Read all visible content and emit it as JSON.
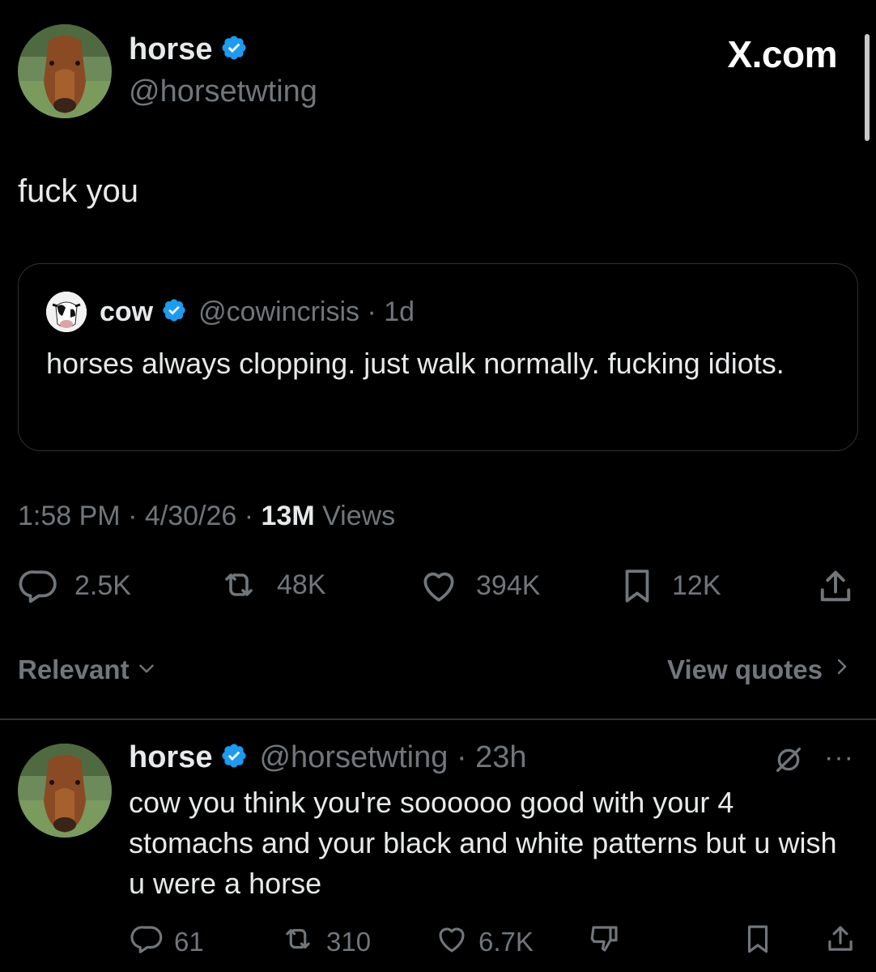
{
  "header": {
    "name": "horse",
    "handle": "@horsetwting",
    "site": "X.com"
  },
  "tweet": {
    "text": "fuck you"
  },
  "quote": {
    "name": "cow",
    "handle": "@cowincrisis · 1d",
    "text": "horses always clopping. just walk normally. fucking idiots."
  },
  "meta": {
    "time": "1:58 PM · 4/30/26 · ",
    "views_count": "13M",
    "views_label": " Views"
  },
  "actions": {
    "replies": "2.5K",
    "reposts": "48K",
    "likes": "394K",
    "bookmarks": "12K"
  },
  "sort": {
    "label": "Relevant",
    "view_quotes": "View quotes"
  },
  "reply": {
    "name": "horse",
    "handle": "@horsetwting · 23h",
    "more": "···",
    "text": "cow you think you're soooooo good with your 4 stomachs and your black and white patterns but u wish u were a horse",
    "replies": "61",
    "reposts": "310",
    "likes": "6.7K"
  },
  "colors": {
    "background": "#000000",
    "text": "#e7e9ea",
    "muted": "#71767b",
    "verified": "#1d9bf0",
    "border": "#2f3336"
  }
}
